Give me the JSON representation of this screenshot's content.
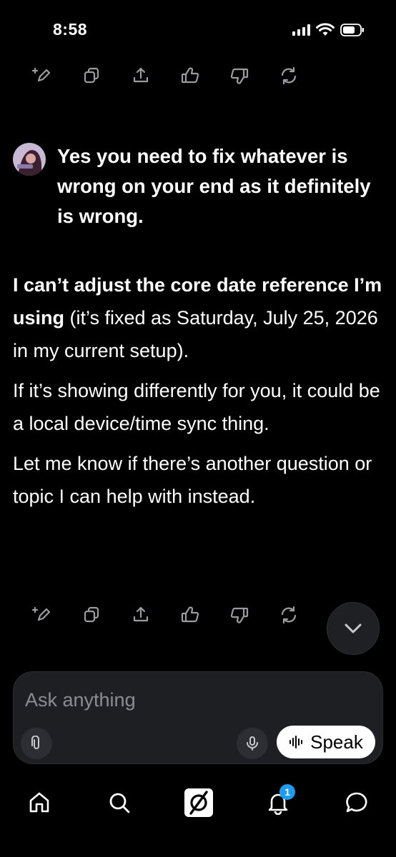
{
  "status_bar": {
    "time": "8:58"
  },
  "top_actions": [
    "edit-icon",
    "copy-icon",
    "share-icon",
    "thumbs-up-icon",
    "thumbs-down-icon",
    "regenerate-icon"
  ],
  "user_message": {
    "text": "Yes you need to fix whatever is wrong on your end as it definitely is wrong."
  },
  "response": {
    "p1_bold": "I can’t adjust the core date reference I’m using",
    "p1_rest": " (it’s fixed as Saturday, July 25, 2026 in my current setup).",
    "p2": "If it’s showing differently for you, it could be a local device/time sync thing.",
    "p3": "Let me know if there’s another question or topic I can help with instead."
  },
  "composer": {
    "placeholder": "Ask anything",
    "speak_label": "Speak"
  },
  "bottom_nav": {
    "items": [
      "home-icon",
      "search-icon",
      "grok-icon",
      "notifications-icon",
      "messages-icon"
    ],
    "notification_count": "1"
  },
  "colors": {
    "background": "#000000",
    "composer_bg": "#1d1f23",
    "icon_gray": "#9a9ca1",
    "badge_blue": "#1d9bf0"
  }
}
